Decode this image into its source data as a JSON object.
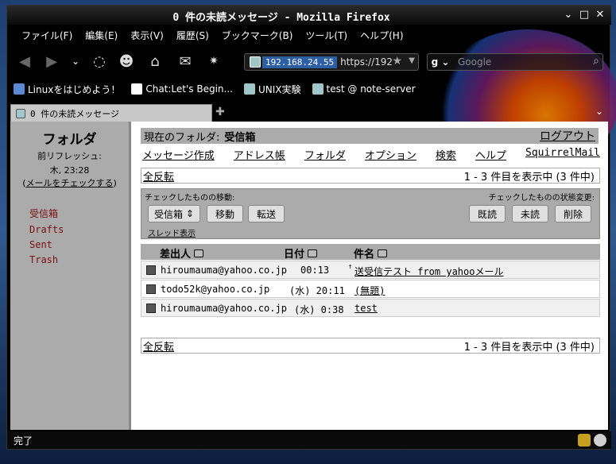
{
  "window": {
    "title": "0 件の未読メッセージ - Mozilla Firefox"
  },
  "menubar": [
    "ファイル(F)",
    "編集(E)",
    "表示(V)",
    "履歴(S)",
    "ブックマーク(B)",
    "ツール(T)",
    "ヘルプ(H)"
  ],
  "url": {
    "host": "192.168.24.55",
    "rest": "https://192"
  },
  "search": {
    "placeholder": "Google"
  },
  "bookmarks": [
    "Linuxをはじめよう！",
    "Chat:Let's Begin...",
    "UNIX実験",
    "test @ note-server"
  ],
  "tab": {
    "label": "0 件の未読メッセージ"
  },
  "left": {
    "title": "フォルダ",
    "refresh_label": "前リフレッシュ:",
    "refresh_time": "木, 23:28",
    "check_mail": "メールをチェックする",
    "folders": [
      "受信箱",
      "Drafts",
      "Sent",
      "Trash"
    ]
  },
  "right": {
    "current_folder_label": "現在のフォルダ:",
    "current_folder": "受信箱",
    "logout": "ログアウト",
    "links": [
      "メッセージ作成",
      "アドレス帳",
      "フォルダ",
      "オプション",
      "検索",
      "ヘルプ",
      "SquirrelMail"
    ],
    "toggle_all": "全反転",
    "count_text": "1 - 3 件目を表示中 (3 件中)",
    "move_label": "チェックしたものの移動:",
    "status_label": "チェックしたものの状態変更:",
    "move_select": "受信箱",
    "btn_move": "移動",
    "btn_forward": "転送",
    "btn_read": "既読",
    "btn_unread": "未読",
    "btn_delete": "削除",
    "thread_view": "スレッド表示",
    "col_from": "差出人",
    "col_date": "日付",
    "col_subject": "件名"
  },
  "messages": [
    {
      "from": "hiroumauma@yahoo.co.jp",
      "date": "00:13",
      "subject": "送受信テスト from yahooメール"
    },
    {
      "from": "todo52k@yahoo.co.jp",
      "date": "(水) 20:11",
      "subject": "(無題)"
    },
    {
      "from": "hiroumauma@yahoo.co.jp",
      "date": "(水) 0:38",
      "subject": "test"
    }
  ],
  "status": {
    "text": "完了"
  }
}
